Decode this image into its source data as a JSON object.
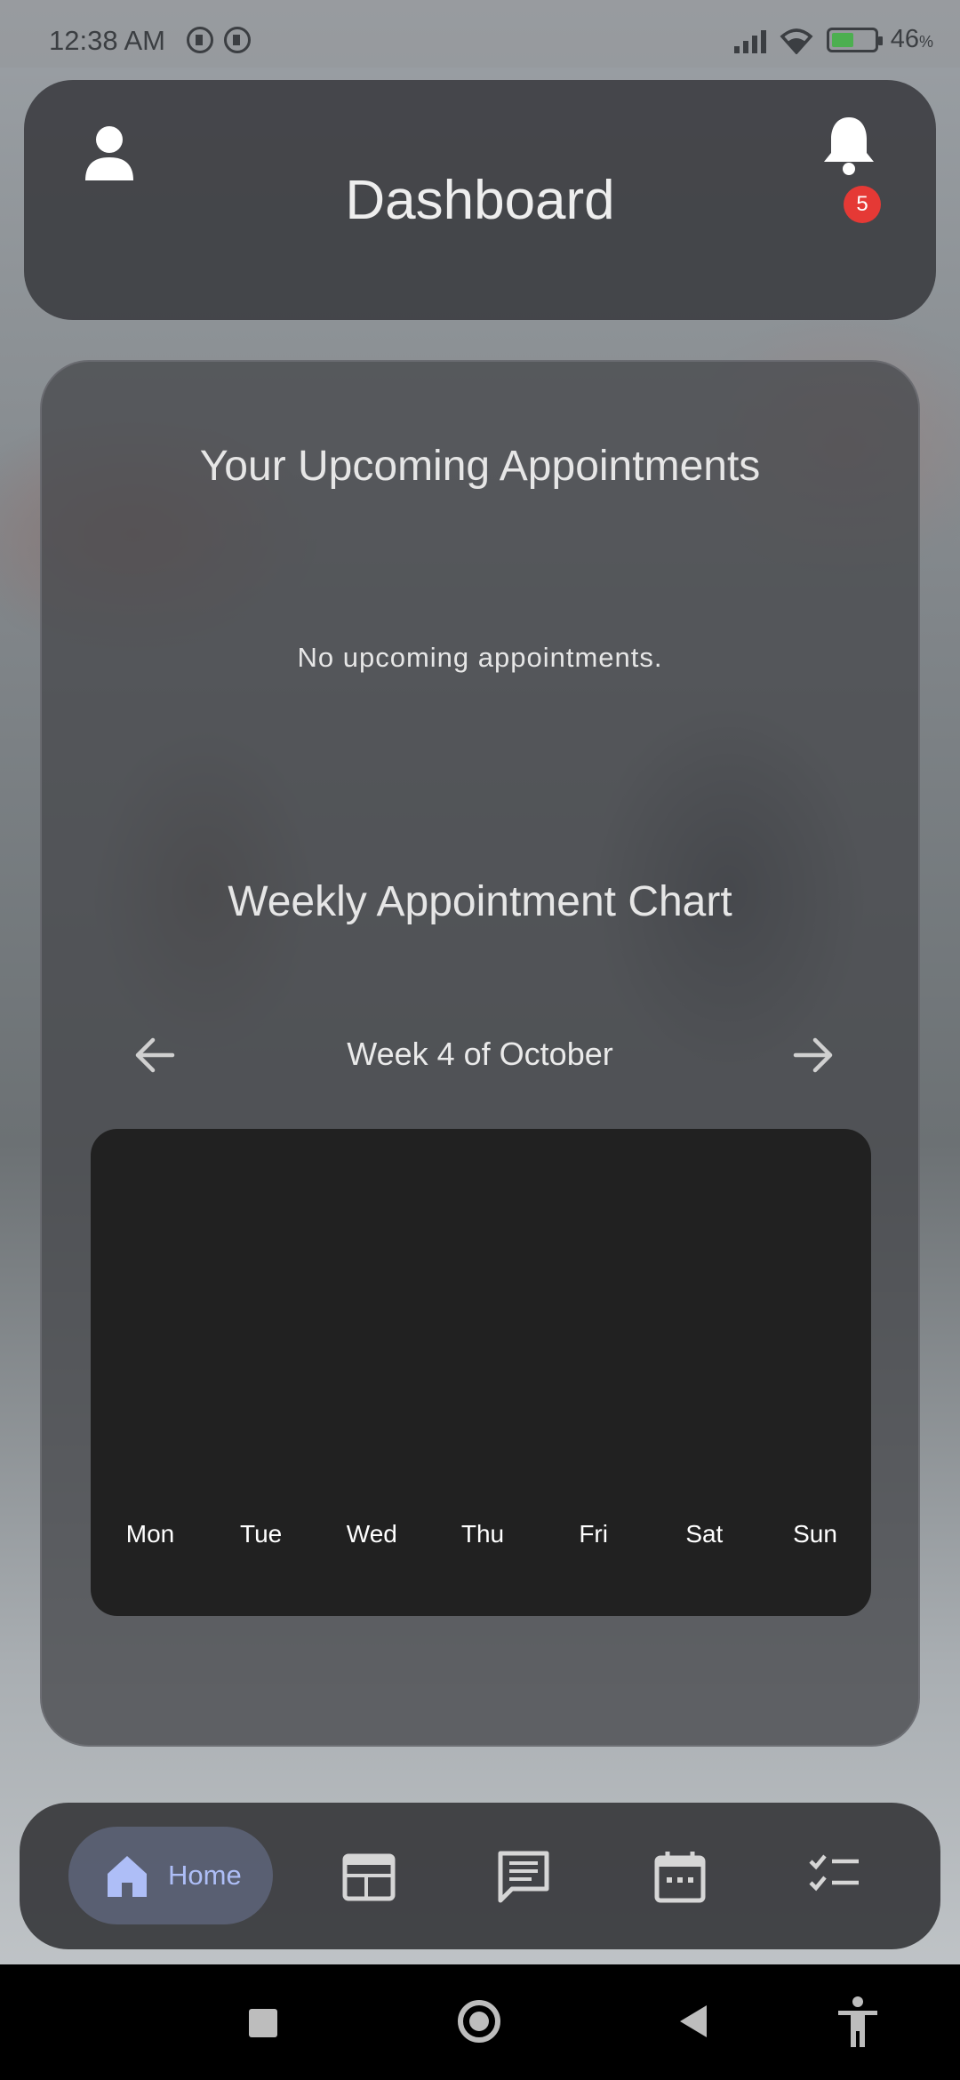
{
  "status_bar": {
    "time": "12:38 AM",
    "battery_percent": "46",
    "battery_suffix": "%"
  },
  "header": {
    "title": "Dashboard",
    "notification_count": "5"
  },
  "appointments": {
    "title": "Your Upcoming Appointments",
    "empty_message": "No upcoming appointments."
  },
  "weekly_chart": {
    "title": "Weekly Appointment Chart",
    "week_label": "Week 4 of October"
  },
  "chart_data": {
    "type": "bar",
    "categories": [
      "Mon",
      "Tue",
      "Wed",
      "Thu",
      "Fri",
      "Sat",
      "Sun"
    ],
    "values": [
      0,
      0,
      0,
      0,
      0,
      0,
      0
    ],
    "title": "",
    "xlabel": "",
    "ylabel": "",
    "grid": false
  },
  "bottom_nav": {
    "home_label": "Home",
    "items": [
      "home-icon",
      "news-icon",
      "chat-icon",
      "calendar-icon",
      "checklist-icon"
    ],
    "active_color": "#aebef7"
  },
  "colors": {
    "badge": "#e53935",
    "chart_bg": "#212121",
    "card_bg": "#48494d"
  }
}
